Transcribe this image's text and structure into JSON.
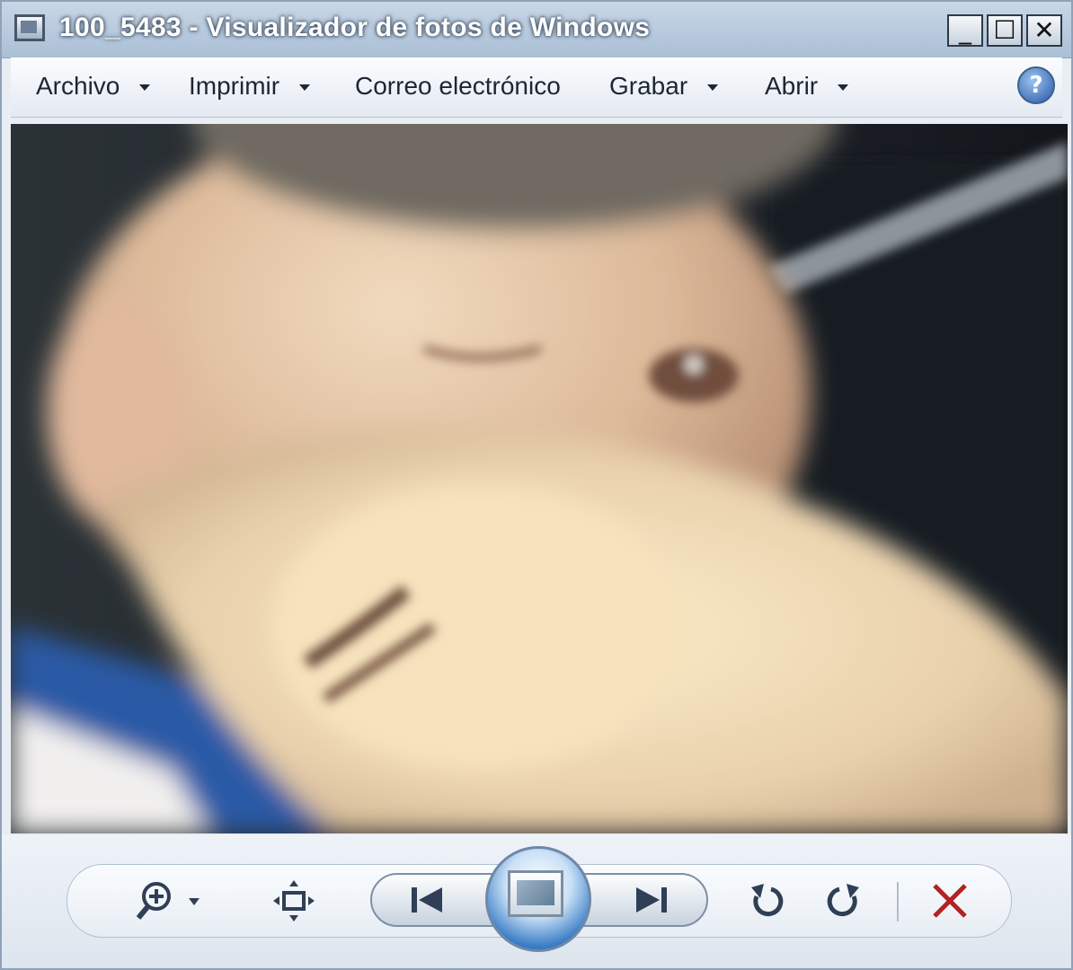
{
  "window": {
    "title": "100_5483 - Visualizador de fotos de Windows",
    "controls": {
      "minimize": "_",
      "maximize": "☐",
      "close": "✕"
    }
  },
  "toolbar": {
    "menus": [
      {
        "label": "Archivo",
        "has_dropdown": true
      },
      {
        "label": "Imprimir",
        "has_dropdown": true
      },
      {
        "label": "Correo electrónico",
        "has_dropdown": false
      },
      {
        "label": "Grabar",
        "has_dropdown": true
      },
      {
        "label": "Abrir",
        "has_dropdown": true
      }
    ],
    "help_symbol": "?"
  },
  "photo": {
    "description_icon": "photo-content",
    "colors": {
      "skin": "#e7c9a8",
      "shirt": "#2a5aa6",
      "background": "#1f232b"
    }
  },
  "controls": {
    "zoom": "zoom-icon",
    "fit": "fit-to-window-icon",
    "previous": "previous-icon",
    "slideshow": "slideshow-icon",
    "next": "next-icon",
    "rotate_left": "rotate-counterclockwise-icon",
    "rotate_right": "rotate-clockwise-icon",
    "delete": "delete-icon",
    "delete_color": "#b32222"
  }
}
